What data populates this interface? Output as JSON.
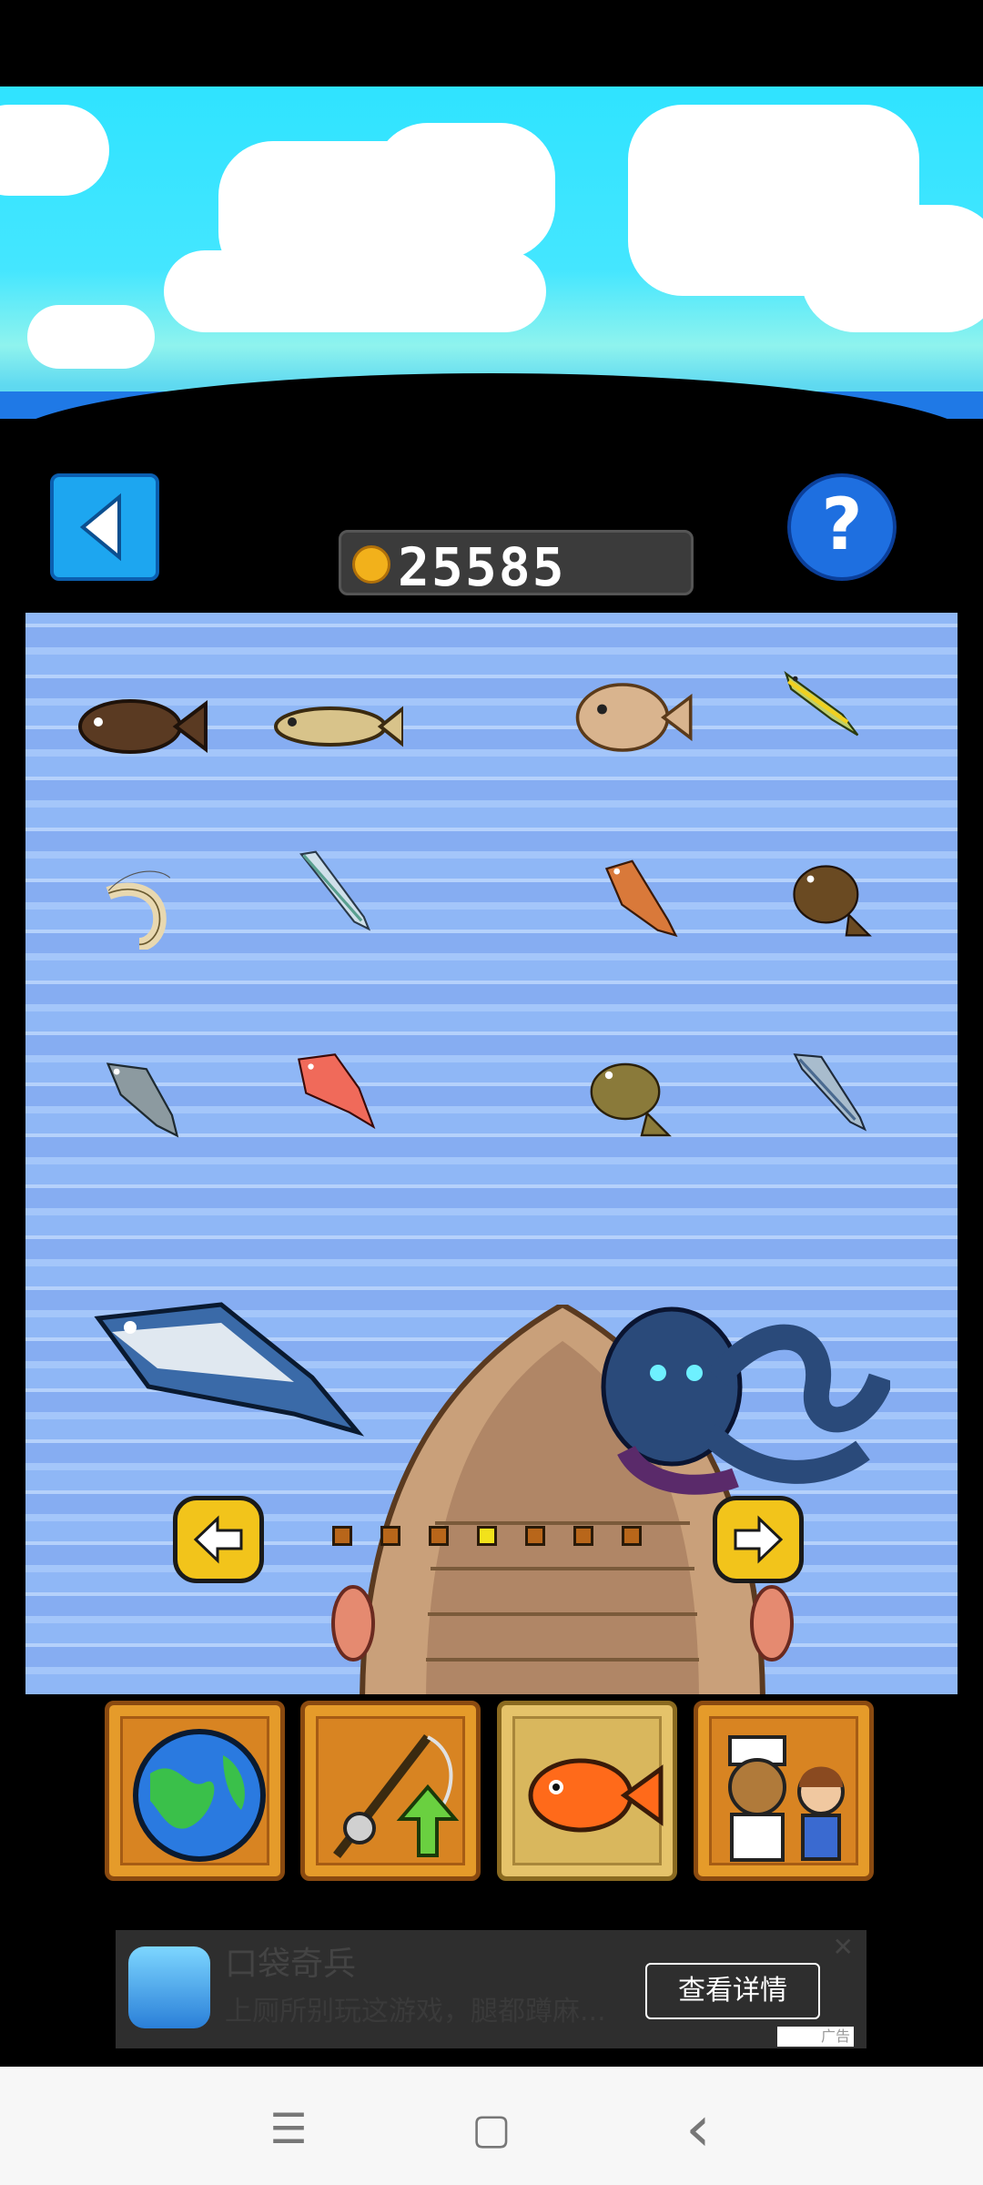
{
  "header": {
    "coins": "25585"
  },
  "buttons": {
    "help_label": "?"
  },
  "fish_grid": [
    [
      "rockfish-icon",
      "goby-icon",
      "blowfish-icon",
      "yellowtail-icon"
    ],
    [
      "shrimp-icon",
      "sardine-icon",
      "red-snapper-icon",
      "flounder-icon"
    ],
    [
      "sea-bass-icon",
      "red-sea-bream-icon",
      "halibut-icon",
      "mackerel-icon"
    ]
  ],
  "page_indicator": {
    "count": 7,
    "current": 4
  },
  "bottom_tabs": [
    "world-map-icon",
    "rod-upgrade-icon",
    "fish-collection-icon",
    "crew-icon"
  ],
  "ad": {
    "title": "口袋奇兵",
    "description": "上厕所别玩这游戏，腿都蹲麻...",
    "cta": "查看详情",
    "label": "广告",
    "close": "✕"
  },
  "navbar": {
    "menu": "☰",
    "home": "▢",
    "back": "‹"
  }
}
